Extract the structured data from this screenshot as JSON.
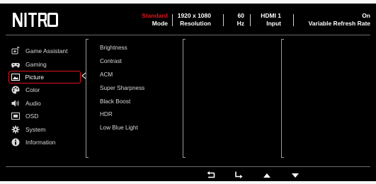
{
  "brand": {
    "logo_text": "NITRO"
  },
  "status": {
    "mode": {
      "value": "Standard",
      "label": "Mode"
    },
    "resolution": {
      "value": "1920 x 1080",
      "label": "Resolution"
    },
    "refresh": {
      "value": "60",
      "label": "Hz"
    },
    "input": {
      "value": "HDMI 1",
      "label": "Input"
    },
    "vrr": {
      "value": "On",
      "label": "Variable Refresh Rate"
    }
  },
  "sidebar": {
    "active_index": 2,
    "items": [
      {
        "label": "Game Assistant",
        "icon": "gamepad-plus-icon"
      },
      {
        "label": "Gaming",
        "icon": "controller-icon"
      },
      {
        "label": "Picture",
        "icon": "picture-icon"
      },
      {
        "label": "Color",
        "icon": "palette-icon"
      },
      {
        "label": "Audio",
        "icon": "speaker-icon"
      },
      {
        "label": "OSD",
        "icon": "osd-window-icon"
      },
      {
        "label": "System",
        "icon": "gear-icon"
      },
      {
        "label": "Information",
        "icon": "info-icon"
      }
    ]
  },
  "submenu": {
    "items": [
      "Brightness",
      "Contrast",
      "ACM",
      "Super Sharpness",
      "Black Boost",
      "HDR",
      "Low Blue Light"
    ]
  },
  "navigation": [
    "back-icon",
    "enter-icon",
    "up-arrow-icon",
    "down-arrow-icon"
  ],
  "colors": {
    "accent": "#e0141e",
    "background": "#000000",
    "text": "#ffffff",
    "frame": "#f7f7f7"
  }
}
